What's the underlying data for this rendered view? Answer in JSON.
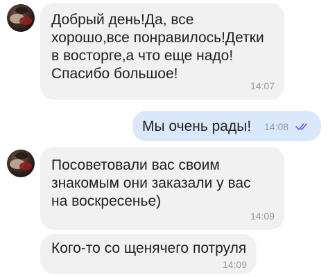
{
  "messages": [
    {
      "direction": "incoming",
      "text": "Добрый день!Да, все\nхорошо,все понравилось!Детки\nв восторге,а что еще надо!\nСпасибо большое!",
      "time": "14:07"
    },
    {
      "direction": "outgoing",
      "text": "Мы очень рады!",
      "time": "14:08",
      "status_icon": "double-check-read"
    },
    {
      "direction": "incoming",
      "text": "Посоветовали вас своим\nзнакомым они заказали у вас\nна воскресенье)",
      "time": "14:09"
    },
    {
      "direction": "incoming",
      "text": "Кого-то со щенячего потруля",
      "time": "14:09"
    }
  ],
  "colors": {
    "incoming_bubble": "#f1f1f1",
    "outgoing_bubble": "#d9e9fb",
    "read_check": "#7b68ee"
  }
}
